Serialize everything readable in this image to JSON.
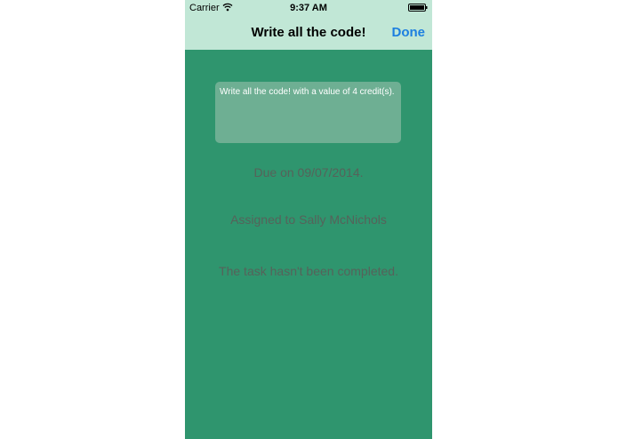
{
  "status_bar": {
    "carrier": "Carrier",
    "time": "9:37 AM",
    "wifi_icon": "wifi-icon",
    "battery_icon": "battery-icon"
  },
  "nav": {
    "title": "Write all the code!",
    "done_label": "Done"
  },
  "task": {
    "description": "Write all the code! with a value of 4 credit(s).",
    "due": "Due on 09/07/2014.",
    "assigned": "Assigned to Sally McNichols",
    "completion": "The task hasn't been completed."
  },
  "colors": {
    "nav_background": "#c1e7d6",
    "content_background": "#2f956e",
    "description_box": "#6eaf93",
    "accent": "#1d7fe0",
    "info_text": "#56625a"
  }
}
